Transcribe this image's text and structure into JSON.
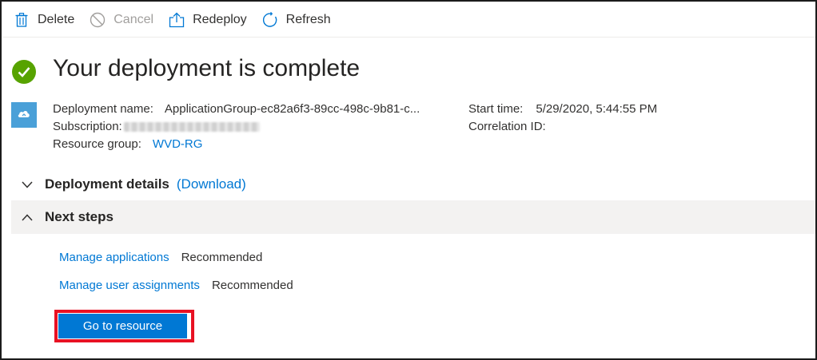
{
  "toolbar": {
    "delete_label": "Delete",
    "cancel_label": "Cancel",
    "redeploy_label": "Redeploy",
    "refresh_label": "Refresh"
  },
  "header": {
    "title": "Your deployment is complete",
    "status_icon": "check-circle-icon",
    "status_color": "#57a300"
  },
  "details": {
    "deployment_name_label": "Deployment name:",
    "deployment_name_value": "ApplicationGroup-ec82a6f3-89cc-498c-9b81-c...",
    "subscription_label": "Subscription:",
    "resource_group_label": "Resource group:",
    "resource_group_value": "WVD-RG",
    "start_time_label": "Start time:",
    "start_time_value": "5/29/2020, 5:44:55 PM",
    "correlation_id_label": "Correlation ID:",
    "correlation_id_value": ""
  },
  "sections": {
    "deployment_details_label": "Deployment details",
    "download_label": "(Download)",
    "next_steps_label": "Next steps"
  },
  "next_steps": [
    {
      "link": "Manage applications",
      "tag": "Recommended"
    },
    {
      "link": "Manage user assignments",
      "tag": "Recommended"
    }
  ],
  "primary_button": {
    "label": "Go to resource",
    "color": "#0078d4",
    "highlight_color": "#e81123"
  },
  "colors": {
    "link": "#0078d4",
    "disabled": "#a19f9d"
  }
}
